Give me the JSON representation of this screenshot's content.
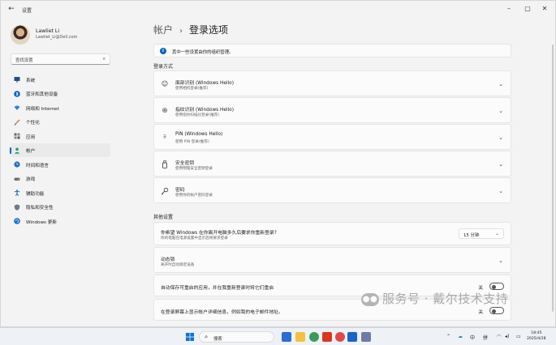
{
  "window": {
    "title": "设置",
    "controls": {
      "minimize": "–",
      "maximize": "▢",
      "close": "✕"
    }
  },
  "user": {
    "name": "Lawliet Li",
    "email": "Lawliet_Li@Dell.com"
  },
  "search": {
    "placeholder": "查找设置"
  },
  "sidebar": {
    "items": [
      {
        "label": "系统",
        "icon": "monitor-icon",
        "color": "#1f4f8a"
      },
      {
        "label": "蓝牙和其他设备",
        "icon": "bluetooth-icon",
        "color": "#0a64c8"
      },
      {
        "label": "网络和 Internet",
        "icon": "wifi-icon",
        "color": "#2b84d6"
      },
      {
        "label": "个性化",
        "icon": "brush-icon",
        "color": "#d07a2a"
      },
      {
        "label": "应用",
        "icon": "apps-icon",
        "color": "#555555"
      },
      {
        "label": "帐户",
        "icon": "person-icon",
        "color": "#1e9e62",
        "active": true
      },
      {
        "label": "时间和语言",
        "icon": "globe-clock-icon",
        "color": "#1a70c5"
      },
      {
        "label": "游戏",
        "icon": "gamepad-icon",
        "color": "#6b6b6b"
      },
      {
        "label": "辅助功能",
        "icon": "accessibility-icon",
        "color": "#1470cc"
      },
      {
        "label": "隐私和安全性",
        "icon": "shield-icon",
        "color": "#6f7a87"
      },
      {
        "label": "Windows 更新",
        "icon": "update-icon",
        "color": "#1470cc"
      }
    ],
    "accent": "#0067c0"
  },
  "breadcrumb": {
    "parent": "帐户",
    "separator": "›",
    "current": "登录选项"
  },
  "info_banner": {
    "text": "其中一些设置由你的组织管理。"
  },
  "sign_in_section": {
    "heading": "登录方式",
    "options": [
      {
        "title": "面部识别 (Windows Hello)",
        "desc": "使用相机登录(推荐)",
        "icon": "face-icon"
      },
      {
        "title": "指纹识别 (Windows Hello)",
        "desc": "使用指纹扫描仪登录(推荐)",
        "icon": "fingerprint-icon"
      },
      {
        "title": "PIN (Windows Hello)",
        "desc": "使用 PIN 登录(推荐)",
        "icon": "pin-keypad-icon"
      },
      {
        "title": "安全密钥",
        "desc": "使用物理安全密钥登录",
        "icon": "usb-key-icon"
      },
      {
        "title": "密码",
        "desc": "使用你的帐户密码登录",
        "icon": "key-icon"
      }
    ]
  },
  "other_section": {
    "heading": "其他设置",
    "require_signin": {
      "title": "你希望 Windows 在你离开电脑多久后要求你重新登录?",
      "desc": "你的电脑在电源设置中显示后将要求登录",
      "value": "15 分钟"
    },
    "dynamic_lock": {
      "title": "动态锁",
      "desc": "离开时自动锁定设备"
    },
    "auto_restart": {
      "title": "自动保存可重启的应用，并在我重新登录时将它们重启",
      "state": "关"
    },
    "show_details": {
      "title": "在登录屏幕上显示帐户详细信息，例如我的电子邮件地址。",
      "state": "关"
    }
  },
  "watermark": {
    "text": "服务号 · 戴尔技术支持"
  },
  "taskbar": {
    "search_placeholder": "搜索",
    "tray": {
      "lang1": "中",
      "lang2": "拼"
    },
    "clock": {
      "time": "18:45",
      "date": "2025/4/28"
    }
  }
}
